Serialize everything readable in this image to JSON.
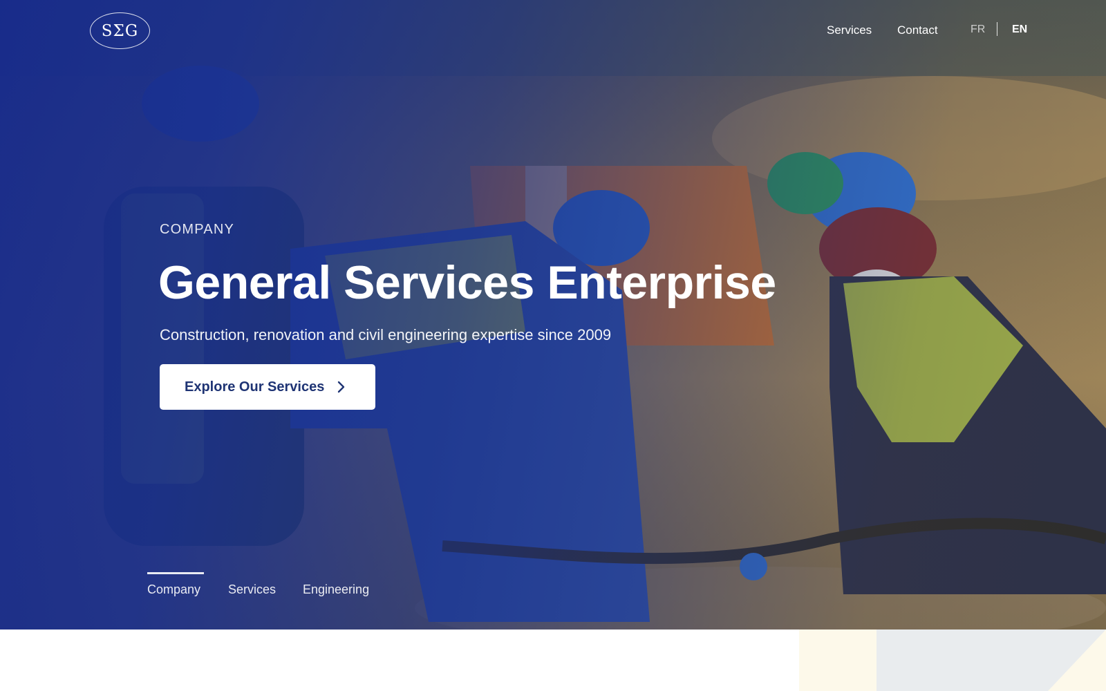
{
  "brand": {
    "logo_text": "SΣG"
  },
  "nav": {
    "links": [
      {
        "label": "Services"
      },
      {
        "label": "Contact"
      }
    ],
    "languages": [
      {
        "label": "FR",
        "active": false
      },
      {
        "label": "EN",
        "active": true
      }
    ]
  },
  "hero": {
    "eyebrow": "COMPANY",
    "title": "General Services Enterprise",
    "subtitle": "Construction, renovation and civil engineering expertise since 2009",
    "cta_label": "Explore Our Services",
    "cta_icon": "chevron-right-icon"
  },
  "tabs": [
    {
      "label": "Company",
      "active": true
    },
    {
      "label": "Services",
      "active": false
    },
    {
      "label": "Engineering",
      "active": false
    }
  ],
  "colors": {
    "overlay_blue": "#172c8c",
    "cta_text": "#1f3474",
    "cream_panel": "#fdf9ea",
    "grey_panel": "#e9ecee"
  }
}
